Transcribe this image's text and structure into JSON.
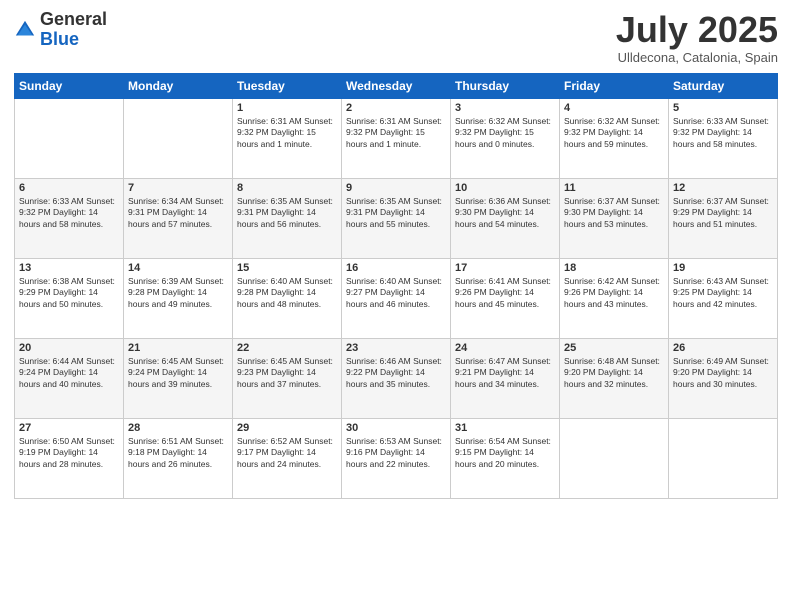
{
  "header": {
    "logo_general": "General",
    "logo_blue": "Blue",
    "month_title": "July 2025",
    "subtitle": "Ulldecona, Catalonia, Spain"
  },
  "days_of_week": [
    "Sunday",
    "Monday",
    "Tuesday",
    "Wednesday",
    "Thursday",
    "Friday",
    "Saturday"
  ],
  "weeks": [
    [
      {
        "num": "",
        "detail": ""
      },
      {
        "num": "",
        "detail": ""
      },
      {
        "num": "1",
        "detail": "Sunrise: 6:31 AM\nSunset: 9:32 PM\nDaylight: 15 hours\nand 1 minute."
      },
      {
        "num": "2",
        "detail": "Sunrise: 6:31 AM\nSunset: 9:32 PM\nDaylight: 15 hours\nand 1 minute."
      },
      {
        "num": "3",
        "detail": "Sunrise: 6:32 AM\nSunset: 9:32 PM\nDaylight: 15 hours\nand 0 minutes."
      },
      {
        "num": "4",
        "detail": "Sunrise: 6:32 AM\nSunset: 9:32 PM\nDaylight: 14 hours\nand 59 minutes."
      },
      {
        "num": "5",
        "detail": "Sunrise: 6:33 AM\nSunset: 9:32 PM\nDaylight: 14 hours\nand 58 minutes."
      }
    ],
    [
      {
        "num": "6",
        "detail": "Sunrise: 6:33 AM\nSunset: 9:32 PM\nDaylight: 14 hours\nand 58 minutes."
      },
      {
        "num": "7",
        "detail": "Sunrise: 6:34 AM\nSunset: 9:31 PM\nDaylight: 14 hours\nand 57 minutes."
      },
      {
        "num": "8",
        "detail": "Sunrise: 6:35 AM\nSunset: 9:31 PM\nDaylight: 14 hours\nand 56 minutes."
      },
      {
        "num": "9",
        "detail": "Sunrise: 6:35 AM\nSunset: 9:31 PM\nDaylight: 14 hours\nand 55 minutes."
      },
      {
        "num": "10",
        "detail": "Sunrise: 6:36 AM\nSunset: 9:30 PM\nDaylight: 14 hours\nand 54 minutes."
      },
      {
        "num": "11",
        "detail": "Sunrise: 6:37 AM\nSunset: 9:30 PM\nDaylight: 14 hours\nand 53 minutes."
      },
      {
        "num": "12",
        "detail": "Sunrise: 6:37 AM\nSunset: 9:29 PM\nDaylight: 14 hours\nand 51 minutes."
      }
    ],
    [
      {
        "num": "13",
        "detail": "Sunrise: 6:38 AM\nSunset: 9:29 PM\nDaylight: 14 hours\nand 50 minutes."
      },
      {
        "num": "14",
        "detail": "Sunrise: 6:39 AM\nSunset: 9:28 PM\nDaylight: 14 hours\nand 49 minutes."
      },
      {
        "num": "15",
        "detail": "Sunrise: 6:40 AM\nSunset: 9:28 PM\nDaylight: 14 hours\nand 48 minutes."
      },
      {
        "num": "16",
        "detail": "Sunrise: 6:40 AM\nSunset: 9:27 PM\nDaylight: 14 hours\nand 46 minutes."
      },
      {
        "num": "17",
        "detail": "Sunrise: 6:41 AM\nSunset: 9:26 PM\nDaylight: 14 hours\nand 45 minutes."
      },
      {
        "num": "18",
        "detail": "Sunrise: 6:42 AM\nSunset: 9:26 PM\nDaylight: 14 hours\nand 43 minutes."
      },
      {
        "num": "19",
        "detail": "Sunrise: 6:43 AM\nSunset: 9:25 PM\nDaylight: 14 hours\nand 42 minutes."
      }
    ],
    [
      {
        "num": "20",
        "detail": "Sunrise: 6:44 AM\nSunset: 9:24 PM\nDaylight: 14 hours\nand 40 minutes."
      },
      {
        "num": "21",
        "detail": "Sunrise: 6:45 AM\nSunset: 9:24 PM\nDaylight: 14 hours\nand 39 minutes."
      },
      {
        "num": "22",
        "detail": "Sunrise: 6:45 AM\nSunset: 9:23 PM\nDaylight: 14 hours\nand 37 minutes."
      },
      {
        "num": "23",
        "detail": "Sunrise: 6:46 AM\nSunset: 9:22 PM\nDaylight: 14 hours\nand 35 minutes."
      },
      {
        "num": "24",
        "detail": "Sunrise: 6:47 AM\nSunset: 9:21 PM\nDaylight: 14 hours\nand 34 minutes."
      },
      {
        "num": "25",
        "detail": "Sunrise: 6:48 AM\nSunset: 9:20 PM\nDaylight: 14 hours\nand 32 minutes."
      },
      {
        "num": "26",
        "detail": "Sunrise: 6:49 AM\nSunset: 9:20 PM\nDaylight: 14 hours\nand 30 minutes."
      }
    ],
    [
      {
        "num": "27",
        "detail": "Sunrise: 6:50 AM\nSunset: 9:19 PM\nDaylight: 14 hours\nand 28 minutes."
      },
      {
        "num": "28",
        "detail": "Sunrise: 6:51 AM\nSunset: 9:18 PM\nDaylight: 14 hours\nand 26 minutes."
      },
      {
        "num": "29",
        "detail": "Sunrise: 6:52 AM\nSunset: 9:17 PM\nDaylight: 14 hours\nand 24 minutes."
      },
      {
        "num": "30",
        "detail": "Sunrise: 6:53 AM\nSunset: 9:16 PM\nDaylight: 14 hours\nand 22 minutes."
      },
      {
        "num": "31",
        "detail": "Sunrise: 6:54 AM\nSunset: 9:15 PM\nDaylight: 14 hours\nand 20 minutes."
      },
      {
        "num": "",
        "detail": ""
      },
      {
        "num": "",
        "detail": ""
      }
    ]
  ]
}
